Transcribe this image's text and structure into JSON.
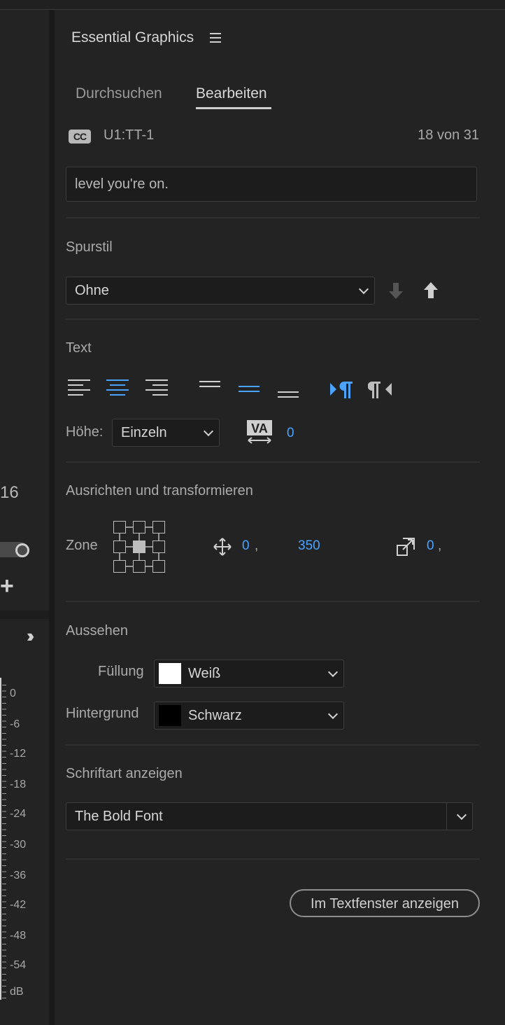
{
  "panel": {
    "title": "Essential Graphics",
    "tabs": [
      {
        "label": "Durchsuchen"
      },
      {
        "label": "Bearbeiten"
      }
    ],
    "active_tab": "Bearbeiten"
  },
  "caption": {
    "badge": "CC",
    "track": "U1:TT-1",
    "counter": "18 von 31",
    "text": "level you're on."
  },
  "track_style": {
    "label": "Spurstil",
    "value": "Ohne"
  },
  "text_section": {
    "label": "Text",
    "height_label": "Höhe:",
    "height_value": "Einzeln",
    "kerning_value": "0",
    "active_alignment": "center",
    "active_vertical": "middle"
  },
  "transform": {
    "label": "Ausrichten und transformieren",
    "zone_label": "Zone",
    "position_x": "0",
    "position_y": "350",
    "scale": "0",
    "comma": ","
  },
  "appearance": {
    "label": "Aussehen",
    "fill_label": "Füllung",
    "fill_value": "Weiß",
    "fill_color": "#ffffff",
    "background_label": "Hintergrund",
    "background_value": "Schwarz",
    "background_color": "#000000"
  },
  "font": {
    "label": "Schriftart anzeigen",
    "value": "The Bold Font"
  },
  "footer": {
    "button_label": "Im Textfenster anzeigen"
  },
  "left_panel": {
    "number": "16",
    "meter_labels": [
      "0",
      "-6",
      "-12",
      "-18",
      "-24",
      "-30",
      "-36",
      "-42",
      "-48",
      "-54",
      "dB"
    ]
  },
  "colors": {
    "accent": "#4aa3ff",
    "panel_bg": "#232323"
  }
}
